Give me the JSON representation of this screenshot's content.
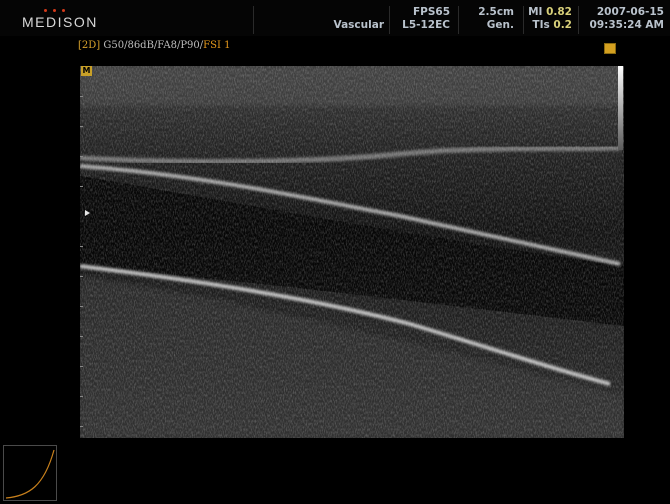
{
  "header": {
    "brand": "MEDISON",
    "application": "Vascular",
    "fps": "FPS65",
    "probe": "L5-12EC",
    "depth": "2.5cm",
    "mode": "Gen.",
    "mi_label": "MI",
    "mi_value": "0.82",
    "tis_label": "TIs",
    "tis_value": "0.2",
    "date": "2007-06-15",
    "time": "09:35:24 AM"
  },
  "status": {
    "mode_tag": "[2D]",
    "params": "G50/86dB/FA8/P90/",
    "fsi": "FSI 1"
  },
  "image": {
    "marker_label": "M"
  },
  "colors": {
    "brand_dots": "#d43a1a",
    "header_value": "#d8d07a",
    "status_accent": "#e69a1c",
    "marker": "#c8a028"
  }
}
